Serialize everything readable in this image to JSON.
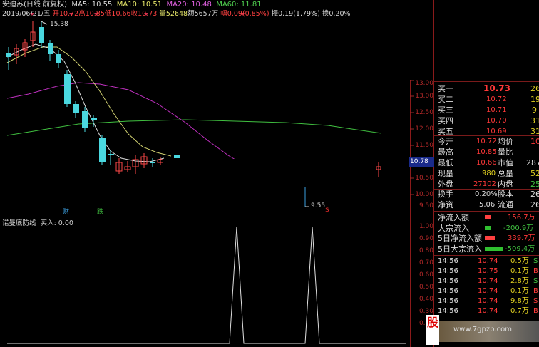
{
  "header": {
    "stock": "安迪苏(日线 前复权)",
    "ma5": "MA5: 10.55",
    "ma10": "MA10: 10.51",
    "ma20": "MA20: 10.48",
    "ma60": "MA60: 11.81",
    "date": "2019/06/21/五",
    "open": "开10.72",
    "high": "高10.85",
    "low": "低10.66",
    "close": "收10.73",
    "volume": "量52648",
    "amount": "额5657万",
    "change": "幅0.09(0.85%)",
    "amplitude": "振0.19(1.79%)",
    "turnover": "换0.20%"
  },
  "chart_labels": {
    "high_marker": "15.38",
    "low_marker": "9.55",
    "event_cai": "财",
    "event_die": "跌",
    "current_price": "10.78"
  },
  "price_axis": [
    "13.00",
    "12.50",
    "12.00",
    "11.50",
    "11.00",
    "10.50",
    "10.00",
    "9.50"
  ],
  "indicator": {
    "title": "诺曼底防线",
    "buy": "买入: 0.00",
    "axis": [
      "1.00",
      "0.90",
      "0.80",
      "0.70",
      "0.60",
      "0.50",
      "0.40",
      "0.30",
      "0.20",
      "0.10"
    ]
  },
  "quote": {
    "buy_levels": [
      {
        "label": "买一",
        "price": "10.73",
        "vol": "26"
      },
      {
        "label": "买二",
        "price": "10.72",
        "vol": "19"
      },
      {
        "label": "买三",
        "price": "10.71",
        "vol": "9"
      },
      {
        "label": "买四",
        "price": "10.70",
        "vol": "31"
      },
      {
        "label": "买五",
        "price": "10.69",
        "vol": "31"
      }
    ],
    "stats": [
      {
        "l1": "今开",
        "v1": "10.72",
        "l2": "均价",
        "v2": "10"
      },
      {
        "l1": "最高",
        "v1": "10.85",
        "l2": "量比",
        "v2": ""
      },
      {
        "l1": "最低",
        "v1": "10.66",
        "l2": "市值",
        "v2": "287"
      },
      {
        "l1": "现量",
        "v1": "980",
        "l2": "总量",
        "v2": "52"
      },
      {
        "l1": "外盘",
        "v1": "27102",
        "l2": "内盘",
        "v2": "25"
      },
      {
        "l1": "换手",
        "v1": "0.20%",
        "l2": "股本",
        "v2": "26"
      },
      {
        "l1": "净资",
        "v1": "5.06",
        "l2": "流通",
        "v2": "26"
      }
    ],
    "flows": [
      {
        "label": "净流入额",
        "value": "156.7万"
      },
      {
        "label": "大宗流入",
        "value": "-200.9万"
      },
      {
        "label": "5日净流入额",
        "value": "339.7万"
      },
      {
        "label": "5日大宗流入",
        "value": "-509.4万"
      }
    ],
    "ticks": [
      {
        "time": "14:56",
        "price": "10.74",
        "vol": "0.5万",
        "side": "S"
      },
      {
        "time": "14:56",
        "price": "10.75",
        "vol": "0.1万",
        "side": "B"
      },
      {
        "time": "14:56",
        "price": "10.74",
        "vol": "2.8万",
        "side": "S"
      },
      {
        "time": "14:56",
        "price": "10.74",
        "vol": "0.1万",
        "side": "B"
      },
      {
        "time": "14:56",
        "price": "10.74",
        "vol": "9.8万",
        "side": "S"
      },
      {
        "time": "14:56",
        "price": "10.74",
        "vol": "0.7万",
        "side": "B"
      }
    ]
  },
  "watermark": "www.7gpzb.com"
}
